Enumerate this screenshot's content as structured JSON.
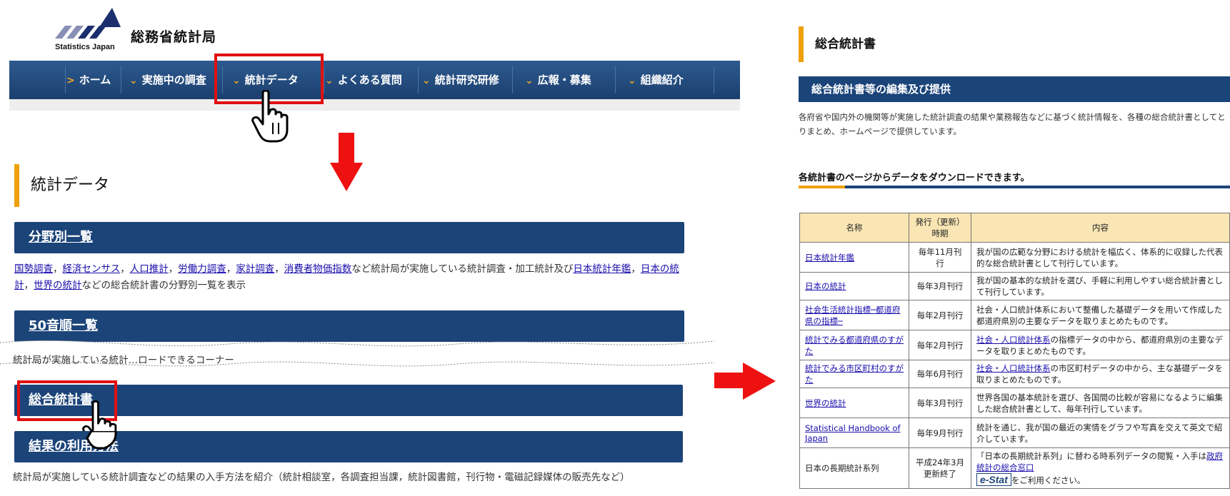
{
  "logo": {
    "name_ja": "総務省統計局",
    "name_en": "Statistics Japan"
  },
  "nav": {
    "items": [
      {
        "label": "ホーム"
      },
      {
        "label": "実施中の調査"
      },
      {
        "label": "統計データ"
      },
      {
        "label": "よくある質問"
      },
      {
        "label": "統計研究研修"
      },
      {
        "label": "広報・募集"
      },
      {
        "label": "組織紹介"
      }
    ]
  },
  "stats_page": {
    "title": "統計データ",
    "sections": [
      {
        "heading": "分野別一覧",
        "desc_links": [
          "国勢調査",
          "経済センサス",
          "人口推計",
          "労働力調査",
          "家計調査",
          "消費者物価指数"
        ],
        "desc_mid": "など統計局が実施している統計調査・加工統計及び",
        "desc_link2": "日本統計年鑑",
        "desc_link3": "日本の統計",
        "desc_link4": "世界の統計",
        "desc_end": "などの総合統計書の分野別一覧を表示"
      },
      {
        "heading": "50音順一覧",
        "desc": "統計局が実施している統計…ロードできるコーナー"
      },
      {
        "heading": "総合統計書"
      },
      {
        "heading": "結果の利用方法",
        "desc": "統計局が実施している統計調査などの結果の入手方法を紹介（統計相談室，各調査担当課，統計図書館，刊行物・電磁記録媒体の販売先など）"
      }
    ]
  },
  "compendium_page": {
    "title": "総合統計書",
    "bar": "総合統計書等の編集及び提供",
    "desc": "各府省や国内外の機関等が実施した統計調査の結果や業務報告などに基づく統計情報を、各種の総合統計書としてとりまとめ、ホームページで提供しています。",
    "subheading": "各統計書のページからデータをダウンロードできます。",
    "table": {
      "headers": [
        "名称",
        "発行（更新）時期",
        "内容"
      ],
      "rows": [
        {
          "name": "日本統計年鑑",
          "freq": "毎年11月刊行",
          "content": "我が国の広範な分野における統計を幅広く、体系的に収録した代表的な総合統計書として刊行しています。"
        },
        {
          "name": "日本の統計",
          "freq": "毎年3月刊行",
          "content": "我が国の基本的な統計を選び、手軽に利用しやすい総合統計書として刊行しています。"
        },
        {
          "name": "社会生活統計指標─都道府県の指標─",
          "freq": "毎年2月刊行",
          "content": "社会・人口統計体系において整備した基礎データを用いて作成した都道府県別の主要なデータを取りまとめたものです。"
        },
        {
          "name": "統計でみる都道府県のすがた",
          "freq": "毎年2月刊行",
          "content_link": "社会・人口統計体系",
          "content": "の指標データの中から、都道府県別の主要なデータを取りまとめたものです。"
        },
        {
          "name": "統計でみる市区町村のすがた",
          "freq": "毎年6月刊行",
          "content_link": "社会・人口統計体系",
          "content": "の市区町村データの中から、主な基礎データを取りまとめたものです。"
        },
        {
          "name": "世界の統計",
          "freq": "毎年3月刊行",
          "content": "世界各国の基本統計を選び、各国間の比較が容易になるように編集した総合統計書として、毎年刊行しています。"
        },
        {
          "name": "Statistical Handbook of Japan",
          "freq": "毎年9月刊行",
          "content": "統計を通じ、我が国の最近の実情をグラフや写真を交えて英文で紹介しています。"
        },
        {
          "name": "日本の長期統計系列",
          "freq": "平成24年3月更新終了",
          "content": "「日本の長期統計系列」に替わる時系列データの閲覧・入手は",
          "content_link": "政府統計の総合窓口",
          "estat": "e-Stat",
          "content_end": "をご利用ください。"
        }
      ]
    }
  },
  "colors": {
    "nav": "#1b4479",
    "accent": "#f0a00a",
    "highlight": "#e01010",
    "table_header": "#f9e6b4"
  },
  "icons": [
    "logo-mark-icon",
    "chevron-right-icon",
    "chevron-down-icon",
    "hand-pointer-icon",
    "down-arrow-icon",
    "right-arrow-icon"
  ]
}
